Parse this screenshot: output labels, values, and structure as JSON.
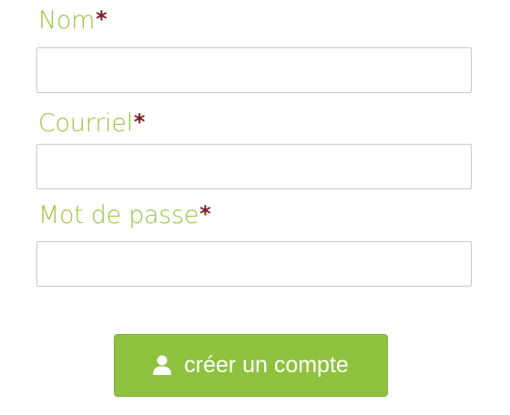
{
  "form": {
    "name_field": {
      "label": "Nom",
      "required_marker": "*",
      "value": "",
      "placeholder": ""
    },
    "email_field": {
      "label": "Courriel",
      "required_marker": "*",
      "value": "",
      "placeholder": ""
    },
    "password_field": {
      "label": "Mot de passe",
      "required_marker": "*",
      "value": "",
      "placeholder": ""
    },
    "submit_button": {
      "label": "créer un compte",
      "icon": "user-icon"
    }
  },
  "colors": {
    "label": "#99c43c",
    "required_marker": "#7a1c22",
    "button_background": "#8fc23f",
    "button_text": "#ffffff",
    "input_border": "#c9c9c9"
  }
}
